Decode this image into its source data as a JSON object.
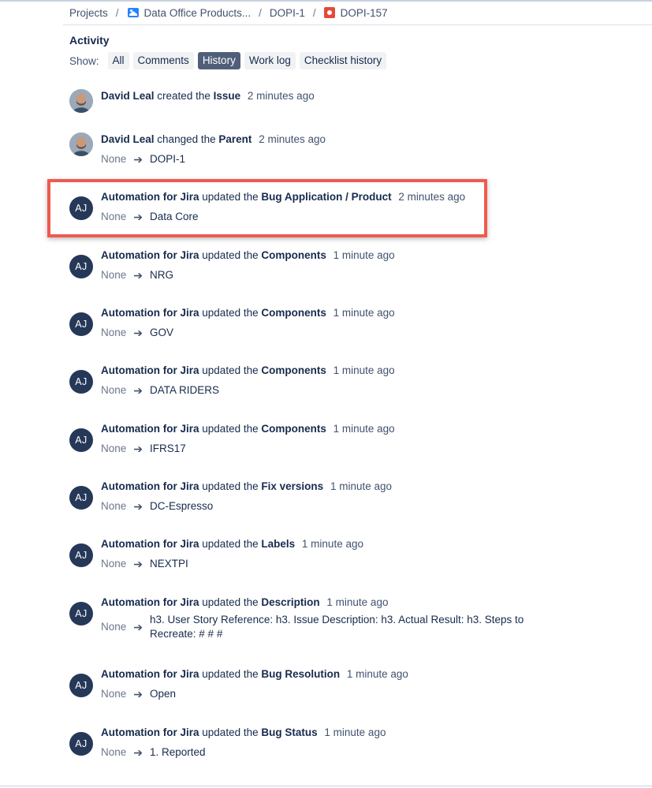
{
  "breadcrumb": {
    "projects": "Projects",
    "project": "Data Office Products...",
    "parent": "DOPI-1",
    "issue": "DOPI-157"
  },
  "activity": {
    "title": "Activity",
    "show_label": "Show:",
    "tabs": [
      "All",
      "Comments",
      "History",
      "Work log",
      "Checklist history"
    ],
    "active_tab": "History"
  },
  "entries": [
    {
      "author": "David Leal",
      "avatar": "photo",
      "action": "created the",
      "field": "Issue",
      "time": "2 minutes ago"
    },
    {
      "author": "David Leal",
      "avatar": "photo",
      "action": "changed the",
      "field": "Parent",
      "time": "2 minutes ago",
      "from": "None",
      "to": "DOPI-1"
    },
    {
      "author": "Automation for Jira",
      "avatar": "AJ",
      "action": "updated the",
      "field": "Bug Application / Product",
      "time": "2 minutes ago",
      "from": "None",
      "to": "Data Core"
    },
    {
      "author": "Automation for Jira",
      "avatar": "AJ",
      "action": "updated the",
      "field": "Components",
      "time": "1 minute ago",
      "from": "None",
      "to": "NRG"
    },
    {
      "author": "Automation for Jira",
      "avatar": "AJ",
      "action": "updated the",
      "field": "Components",
      "time": "1 minute ago",
      "from": "None",
      "to": "GOV"
    },
    {
      "author": "Automation for Jira",
      "avatar": "AJ",
      "action": "updated the",
      "field": "Components",
      "time": "1 minute ago",
      "from": "None",
      "to": "DATA RIDERS"
    },
    {
      "author": "Automation for Jira",
      "avatar": "AJ",
      "action": "updated the",
      "field": "Components",
      "time": "1 minute ago",
      "from": "None",
      "to": "IFRS17"
    },
    {
      "author": "Automation for Jira",
      "avatar": "AJ",
      "action": "updated the",
      "field": "Fix versions",
      "time": "1 minute ago",
      "from": "None",
      "to": "DC-Espresso"
    },
    {
      "author": "Automation for Jira",
      "avatar": "AJ",
      "action": "updated the",
      "field": "Labels",
      "time": "1 minute ago",
      "from": "None",
      "to": "NEXTPI"
    },
    {
      "author": "Automation for Jira",
      "avatar": "AJ",
      "action": "updated the",
      "field": "Description",
      "time": "1 minute ago",
      "from": "None",
      "to": "h3. User Story Reference: h3. Issue Description: h3. Actual Result: h3. Steps to Recreate: # # #"
    },
    {
      "author": "Automation for Jira",
      "avatar": "AJ",
      "action": "updated the",
      "field": "Bug Resolution",
      "time": "1 minute ago",
      "from": "None",
      "to": "Open"
    },
    {
      "author": "Automation for Jira",
      "avatar": "AJ",
      "action": "updated the",
      "field": "Bug Status",
      "time": "1 minute ago",
      "from": "None",
      "to": "1. Reported"
    }
  ],
  "colors": {
    "highlight_border": "#ef5a4f",
    "avatar_bg": "#253858",
    "active_tab_bg": "#505f79",
    "issue_type_bug": "#e5493a"
  },
  "icons": {
    "project": "project-avatar-icon",
    "issue_type": "bug-icon",
    "arrow": "arrow-right-icon"
  }
}
